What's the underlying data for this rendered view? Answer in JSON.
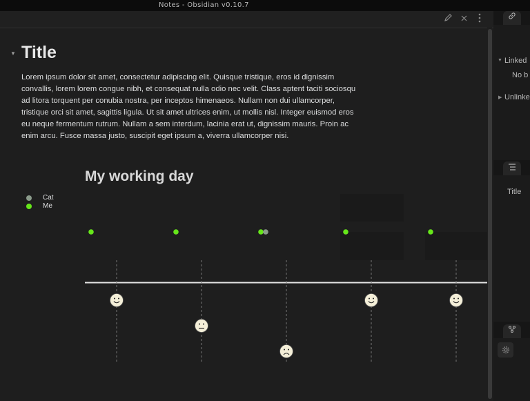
{
  "window": {
    "title": "Notes - Obsidian v0.10.7"
  },
  "toolbar": {
    "edit_icon": "pencil-icon",
    "close_icon": "close-icon",
    "more_icon": "more-vertical-icon"
  },
  "note": {
    "title": "Title",
    "body": "Lorem ipsum dolor sit amet, consectetur adipiscing elit. Quisque tristique, eros id dignissim convallis, lorem lorem congue nibh, et consequat nulla odio nec velit. Class aptent taciti sociosqu ad litora torquent per conubia nostra, per inceptos himenaeos. Nullam non dui ullamcorper, tristique orci sit amet, sagittis ligula. Ut sit amet ultrices enim, ut mollis nisl. Integer euismod eros eu neque fermentum rutrum. Nullam a sem interdum, lacinia erat ut, dignissim mauris. Proin ac enim arcu. Fusce massa justo, suscipit eget ipsum a, viverra ullamcorper nisi."
  },
  "chart_data": {
    "type": "scatter",
    "title": "My working day",
    "legend": [
      {
        "name": "Cat",
        "color": "#8a9a8a"
      },
      {
        "name": "Me",
        "color": "#66e61a"
      }
    ],
    "legend_position": "top-left",
    "points": [
      {
        "series": "Me",
        "x": 1
      },
      {
        "series": "Me",
        "x": 2
      },
      {
        "series": "Me",
        "x": 3
      },
      {
        "series": "Cat",
        "x": 3
      },
      {
        "series": "Me",
        "x": 4
      },
      {
        "series": "Me",
        "x": 5
      }
    ],
    "moods": [
      {
        "x": 1,
        "mood": "happy"
      },
      {
        "x": 2,
        "mood": "neutral"
      },
      {
        "x": 3,
        "mood": "sad"
      },
      {
        "x": 4,
        "mood": "happy"
      },
      {
        "x": 5,
        "mood": "happy"
      }
    ]
  },
  "sidebar": {
    "link_icon": "link-icon",
    "linked_label": "Linked",
    "no_backlinks": "No b",
    "unlinked_label": "Unlinke",
    "outline_icon": "outline-list-icon",
    "outline_item": "Title",
    "graph_icon": "graph-icon",
    "settings_icon": "gear-icon"
  }
}
